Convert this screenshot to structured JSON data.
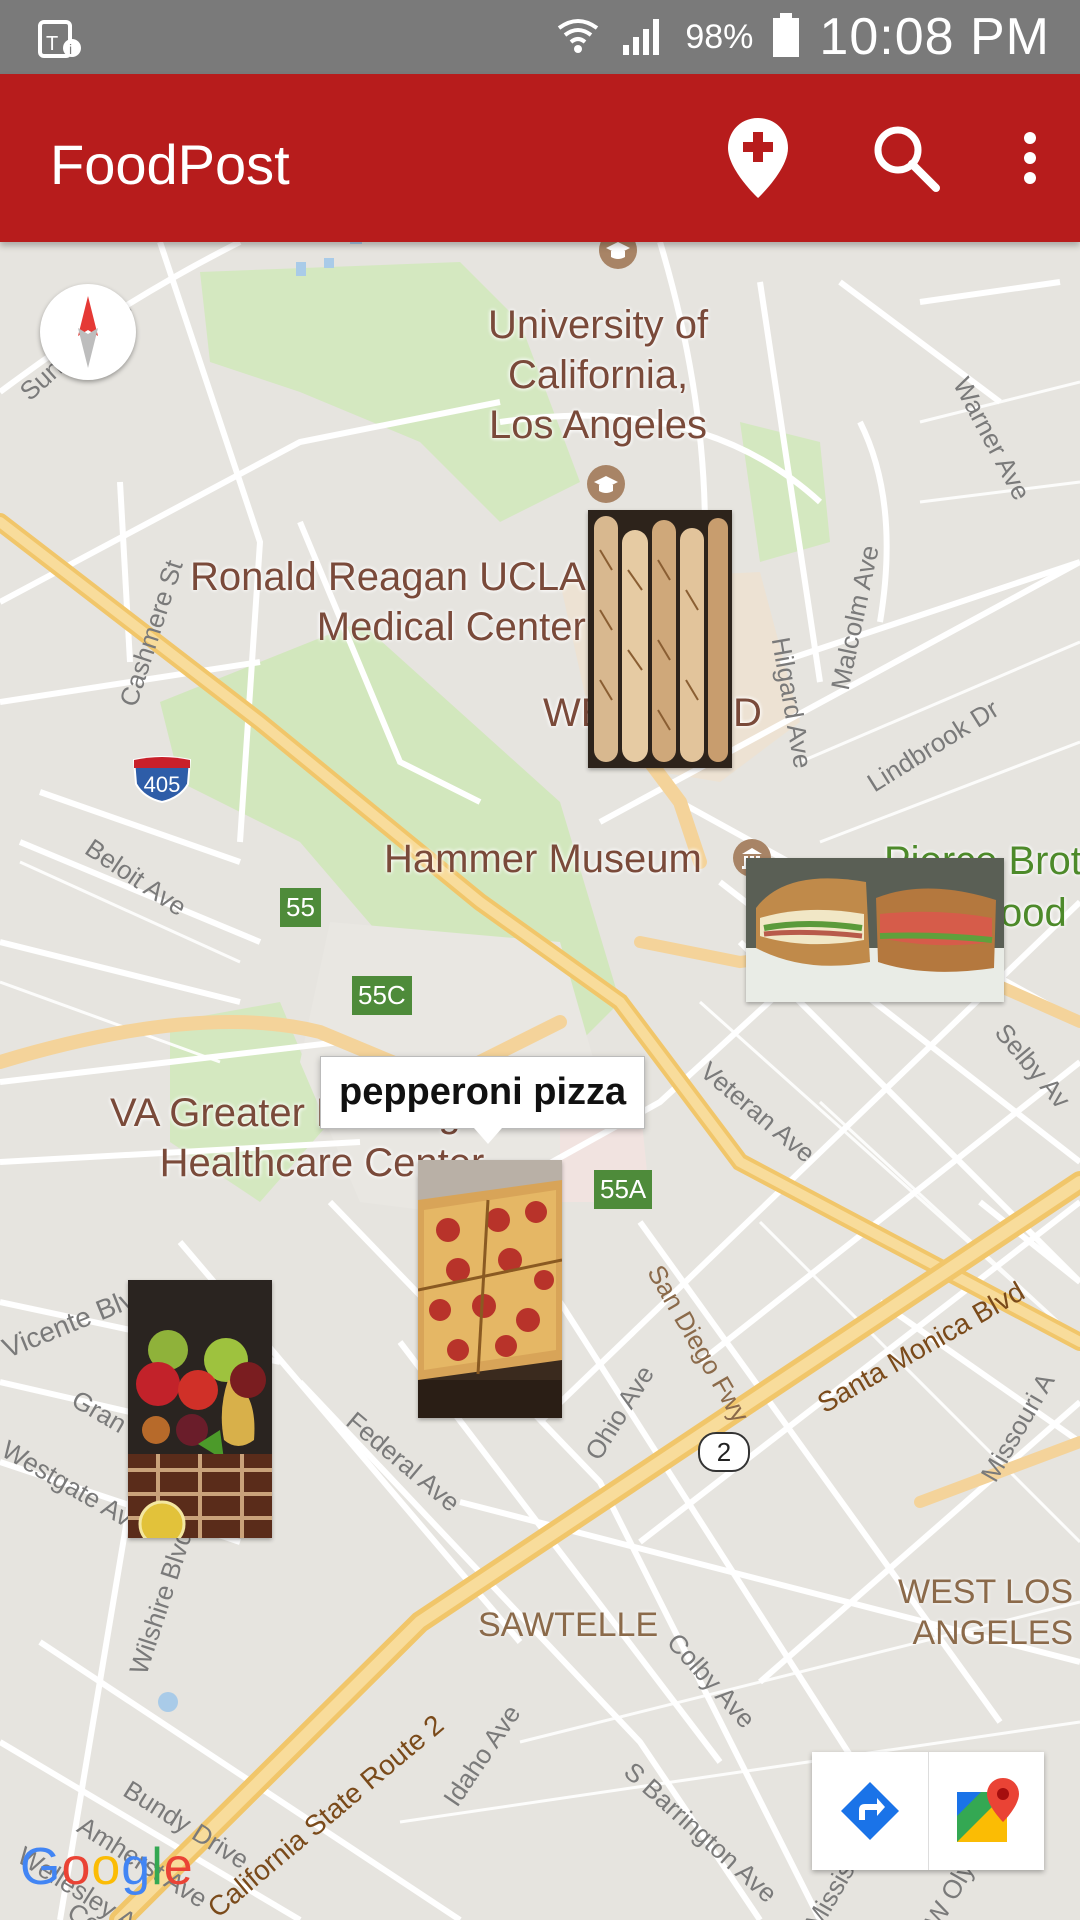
{
  "status_bar": {
    "battery": "98%",
    "time": "10:08 PM"
  },
  "app_bar": {
    "title": "FoodPost",
    "add_post_icon": "add-location-icon",
    "search_icon": "search-icon",
    "overflow_icon": "more-vert-icon"
  },
  "map": {
    "pois": {
      "ucla": "University of\nCalifornia,\nLos Angeles",
      "reagan": "Ronald Reagan UCLA\nMedical Center",
      "westwood_partial_1": "WE",
      "westwood_partial_2": "D",
      "hammer": "Hammer Museum",
      "va": "VA Greater Los Angeles\nHealthcare Center",
      "pierce_1": "Pierce Brot",
      "pierce_2": "ood",
      "sawtelle": "SAWTELLE",
      "west_la": "WEST LOS\nANGELES"
    },
    "streets": {
      "sunset": "Sunset Blvd",
      "cashmere": "Cashmere St",
      "beloit": "Beloit Ave",
      "warner": "Warner Ave",
      "malcolm": "Malcolm Ave",
      "hilgard": "Hilgard Ave",
      "lindbrook": "Lindbrook Dr",
      "veteran": "Veteran Ave",
      "selby": "Selby Av",
      "vicente": "Vicente Blvd",
      "gran": "Gran",
      "westgate": "Westgate Ave",
      "federal": "Federal Ave",
      "ohio": "Ohio Ave",
      "sandiego": "San Diego Fwy",
      "santamonica": "Santa Monica Blvd",
      "missouri": "Missouri A",
      "wilshire": "Wilshire Blvd",
      "colby": "Colby Ave",
      "idaho": "Idaho Ave",
      "barrington": "S Barrington Ave",
      "bundy": "Bundy Drive",
      "amherst": "Amherst Ave",
      "wellesley": "Wellesley Ave",
      "route2": "California State Route 2",
      "mississippi": "Mississippi Ave",
      "wolympic": "W Olympic Blvd",
      "centinela": "Centinela"
    },
    "shields": {
      "i405": "405",
      "exit55": "55",
      "exit55c": "55C",
      "exit55a": "55A",
      "route2": "2"
    },
    "info_window": "pepperoni pizza",
    "markers": [
      {
        "name": "baguettes",
        "icon": "baguette-photo"
      },
      {
        "name": "sandwich",
        "icon": "sandwich-photo"
      },
      {
        "name": "pepperoni pizza",
        "icon": "pizza-photo"
      },
      {
        "name": "fruit basket",
        "icon": "fruit-photo"
      }
    ],
    "google_logo": "Google"
  },
  "colors": {
    "app_bar": "#b71c1c",
    "status_bar": "#7a7a7a",
    "park_green": "#cfe6b8",
    "highway": "#f6d48a"
  }
}
